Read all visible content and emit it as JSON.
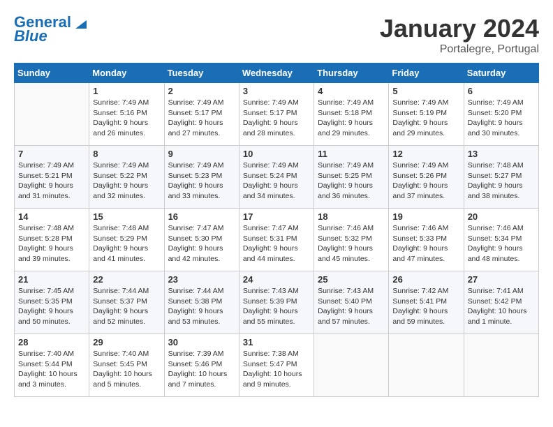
{
  "header": {
    "logo_line1": "General",
    "logo_line2": "Blue",
    "month": "January 2024",
    "location": "Portalegre, Portugal"
  },
  "days_of_week": [
    "Sunday",
    "Monday",
    "Tuesday",
    "Wednesday",
    "Thursday",
    "Friday",
    "Saturday"
  ],
  "weeks": [
    [
      {
        "day": "",
        "sunrise": "",
        "sunset": "",
        "daylight": ""
      },
      {
        "day": "1",
        "sunrise": "Sunrise: 7:49 AM",
        "sunset": "Sunset: 5:16 PM",
        "daylight": "Daylight: 9 hours and 26 minutes."
      },
      {
        "day": "2",
        "sunrise": "Sunrise: 7:49 AM",
        "sunset": "Sunset: 5:17 PM",
        "daylight": "Daylight: 9 hours and 27 minutes."
      },
      {
        "day": "3",
        "sunrise": "Sunrise: 7:49 AM",
        "sunset": "Sunset: 5:17 PM",
        "daylight": "Daylight: 9 hours and 28 minutes."
      },
      {
        "day": "4",
        "sunrise": "Sunrise: 7:49 AM",
        "sunset": "Sunset: 5:18 PM",
        "daylight": "Daylight: 9 hours and 29 minutes."
      },
      {
        "day": "5",
        "sunrise": "Sunrise: 7:49 AM",
        "sunset": "Sunset: 5:19 PM",
        "daylight": "Daylight: 9 hours and 29 minutes."
      },
      {
        "day": "6",
        "sunrise": "Sunrise: 7:49 AM",
        "sunset": "Sunset: 5:20 PM",
        "daylight": "Daylight: 9 hours and 30 minutes."
      }
    ],
    [
      {
        "day": "7",
        "sunrise": "Sunrise: 7:49 AM",
        "sunset": "Sunset: 5:21 PM",
        "daylight": "Daylight: 9 hours and 31 minutes."
      },
      {
        "day": "8",
        "sunrise": "Sunrise: 7:49 AM",
        "sunset": "Sunset: 5:22 PM",
        "daylight": "Daylight: 9 hours and 32 minutes."
      },
      {
        "day": "9",
        "sunrise": "Sunrise: 7:49 AM",
        "sunset": "Sunset: 5:23 PM",
        "daylight": "Daylight: 9 hours and 33 minutes."
      },
      {
        "day": "10",
        "sunrise": "Sunrise: 7:49 AM",
        "sunset": "Sunset: 5:24 PM",
        "daylight": "Daylight: 9 hours and 34 minutes."
      },
      {
        "day": "11",
        "sunrise": "Sunrise: 7:49 AM",
        "sunset": "Sunset: 5:25 PM",
        "daylight": "Daylight: 9 hours and 36 minutes."
      },
      {
        "day": "12",
        "sunrise": "Sunrise: 7:49 AM",
        "sunset": "Sunset: 5:26 PM",
        "daylight": "Daylight: 9 hours and 37 minutes."
      },
      {
        "day": "13",
        "sunrise": "Sunrise: 7:48 AM",
        "sunset": "Sunset: 5:27 PM",
        "daylight": "Daylight: 9 hours and 38 minutes."
      }
    ],
    [
      {
        "day": "14",
        "sunrise": "Sunrise: 7:48 AM",
        "sunset": "Sunset: 5:28 PM",
        "daylight": "Daylight: 9 hours and 39 minutes."
      },
      {
        "day": "15",
        "sunrise": "Sunrise: 7:48 AM",
        "sunset": "Sunset: 5:29 PM",
        "daylight": "Daylight: 9 hours and 41 minutes."
      },
      {
        "day": "16",
        "sunrise": "Sunrise: 7:47 AM",
        "sunset": "Sunset: 5:30 PM",
        "daylight": "Daylight: 9 hours and 42 minutes."
      },
      {
        "day": "17",
        "sunrise": "Sunrise: 7:47 AM",
        "sunset": "Sunset: 5:31 PM",
        "daylight": "Daylight: 9 hours and 44 minutes."
      },
      {
        "day": "18",
        "sunrise": "Sunrise: 7:46 AM",
        "sunset": "Sunset: 5:32 PM",
        "daylight": "Daylight: 9 hours and 45 minutes."
      },
      {
        "day": "19",
        "sunrise": "Sunrise: 7:46 AM",
        "sunset": "Sunset: 5:33 PM",
        "daylight": "Daylight: 9 hours and 47 minutes."
      },
      {
        "day": "20",
        "sunrise": "Sunrise: 7:46 AM",
        "sunset": "Sunset: 5:34 PM",
        "daylight": "Daylight: 9 hours and 48 minutes."
      }
    ],
    [
      {
        "day": "21",
        "sunrise": "Sunrise: 7:45 AM",
        "sunset": "Sunset: 5:35 PM",
        "daylight": "Daylight: 9 hours and 50 minutes."
      },
      {
        "day": "22",
        "sunrise": "Sunrise: 7:44 AM",
        "sunset": "Sunset: 5:37 PM",
        "daylight": "Daylight: 9 hours and 52 minutes."
      },
      {
        "day": "23",
        "sunrise": "Sunrise: 7:44 AM",
        "sunset": "Sunset: 5:38 PM",
        "daylight": "Daylight: 9 hours and 53 minutes."
      },
      {
        "day": "24",
        "sunrise": "Sunrise: 7:43 AM",
        "sunset": "Sunset: 5:39 PM",
        "daylight": "Daylight: 9 hours and 55 minutes."
      },
      {
        "day": "25",
        "sunrise": "Sunrise: 7:43 AM",
        "sunset": "Sunset: 5:40 PM",
        "daylight": "Daylight: 9 hours and 57 minutes."
      },
      {
        "day": "26",
        "sunrise": "Sunrise: 7:42 AM",
        "sunset": "Sunset: 5:41 PM",
        "daylight": "Daylight: 9 hours and 59 minutes."
      },
      {
        "day": "27",
        "sunrise": "Sunrise: 7:41 AM",
        "sunset": "Sunset: 5:42 PM",
        "daylight": "Daylight: 10 hours and 1 minute."
      }
    ],
    [
      {
        "day": "28",
        "sunrise": "Sunrise: 7:40 AM",
        "sunset": "Sunset: 5:44 PM",
        "daylight": "Daylight: 10 hours and 3 minutes."
      },
      {
        "day": "29",
        "sunrise": "Sunrise: 7:40 AM",
        "sunset": "Sunset: 5:45 PM",
        "daylight": "Daylight: 10 hours and 5 minutes."
      },
      {
        "day": "30",
        "sunrise": "Sunrise: 7:39 AM",
        "sunset": "Sunset: 5:46 PM",
        "daylight": "Daylight: 10 hours and 7 minutes."
      },
      {
        "day": "31",
        "sunrise": "Sunrise: 7:38 AM",
        "sunset": "Sunset: 5:47 PM",
        "daylight": "Daylight: 10 hours and 9 minutes."
      },
      {
        "day": "",
        "sunrise": "",
        "sunset": "",
        "daylight": ""
      },
      {
        "day": "",
        "sunrise": "",
        "sunset": "",
        "daylight": ""
      },
      {
        "day": "",
        "sunrise": "",
        "sunset": "",
        "daylight": ""
      }
    ]
  ]
}
